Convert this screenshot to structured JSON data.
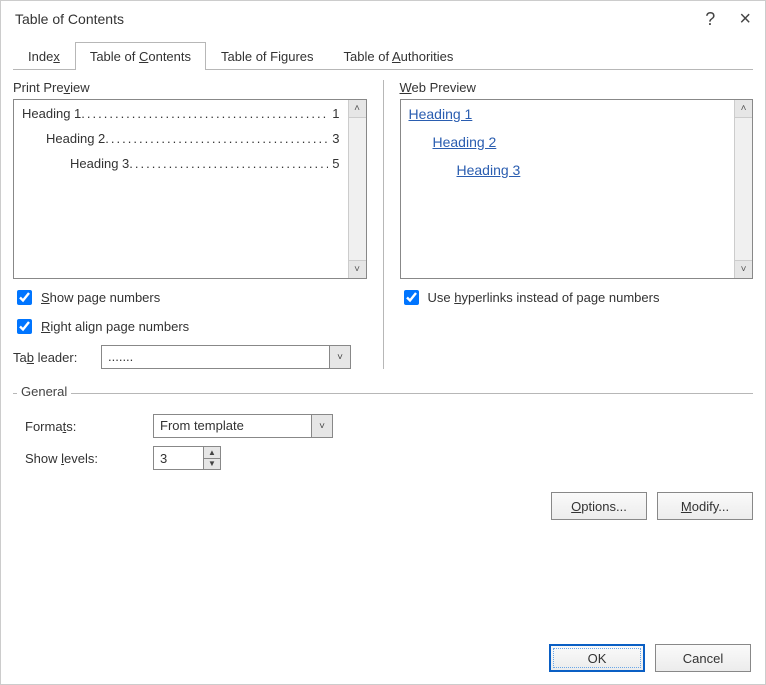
{
  "dialog": {
    "title": "Table of Contents",
    "help_symbol": "?",
    "close_symbol": "×"
  },
  "tabs": [
    {
      "label_pre": "Inde",
      "label_u": "x",
      "label_post": ""
    },
    {
      "label_pre": "Table of ",
      "label_u": "C",
      "label_post": "ontents"
    },
    {
      "label_pre": "Table of Fi",
      "label_u": "g",
      "label_post": "ures"
    },
    {
      "label_pre": "Table of ",
      "label_u": "A",
      "label_post": "uthorities"
    }
  ],
  "print_preview": {
    "label_pre": "Print Pre",
    "label_u": "v",
    "label_post": "iew",
    "rows": [
      {
        "text": "Heading 1",
        "page": "1",
        "level": 1
      },
      {
        "text": "Heading 2",
        "page": "3",
        "level": 2
      },
      {
        "text": "Heading 3",
        "page": "5",
        "level": 3
      }
    ]
  },
  "web_preview": {
    "label_u": "W",
    "label_post": "eb Preview",
    "rows": [
      {
        "text": "Heading 1",
        "level": 1
      },
      {
        "text": "Heading 2",
        "level": 2
      },
      {
        "text": "Heading 3",
        "level": 3
      }
    ]
  },
  "checks": {
    "show_page_numbers": {
      "pre": "",
      "u": "S",
      "post": "how page numbers",
      "checked": true
    },
    "right_align": {
      "pre": "",
      "u": "R",
      "post": "ight align page numbers",
      "checked": true
    },
    "use_hyperlinks": {
      "pre": "Use ",
      "u": "h",
      "post": "yperlinks instead of page numbers",
      "checked": true
    }
  },
  "tab_leader": {
    "label_pre": "Ta",
    "label_u": "b",
    "label_post": " leader:",
    "value": "......."
  },
  "general": {
    "title": "General",
    "formats": {
      "label_pre": "Forma",
      "label_u": "t",
      "label_post": "s:",
      "value": "From template"
    },
    "levels": {
      "label_pre": "Show ",
      "label_u": "l",
      "label_post": "evels:",
      "value": "3"
    }
  },
  "buttons": {
    "options": {
      "u": "O",
      "post": "ptions..."
    },
    "modify": {
      "u": "M",
      "post": "odify..."
    },
    "ok": "OK",
    "cancel": "Cancel"
  },
  "leader_dots": "............................................",
  "scroll": {
    "up": "˄",
    "down": "˅"
  }
}
